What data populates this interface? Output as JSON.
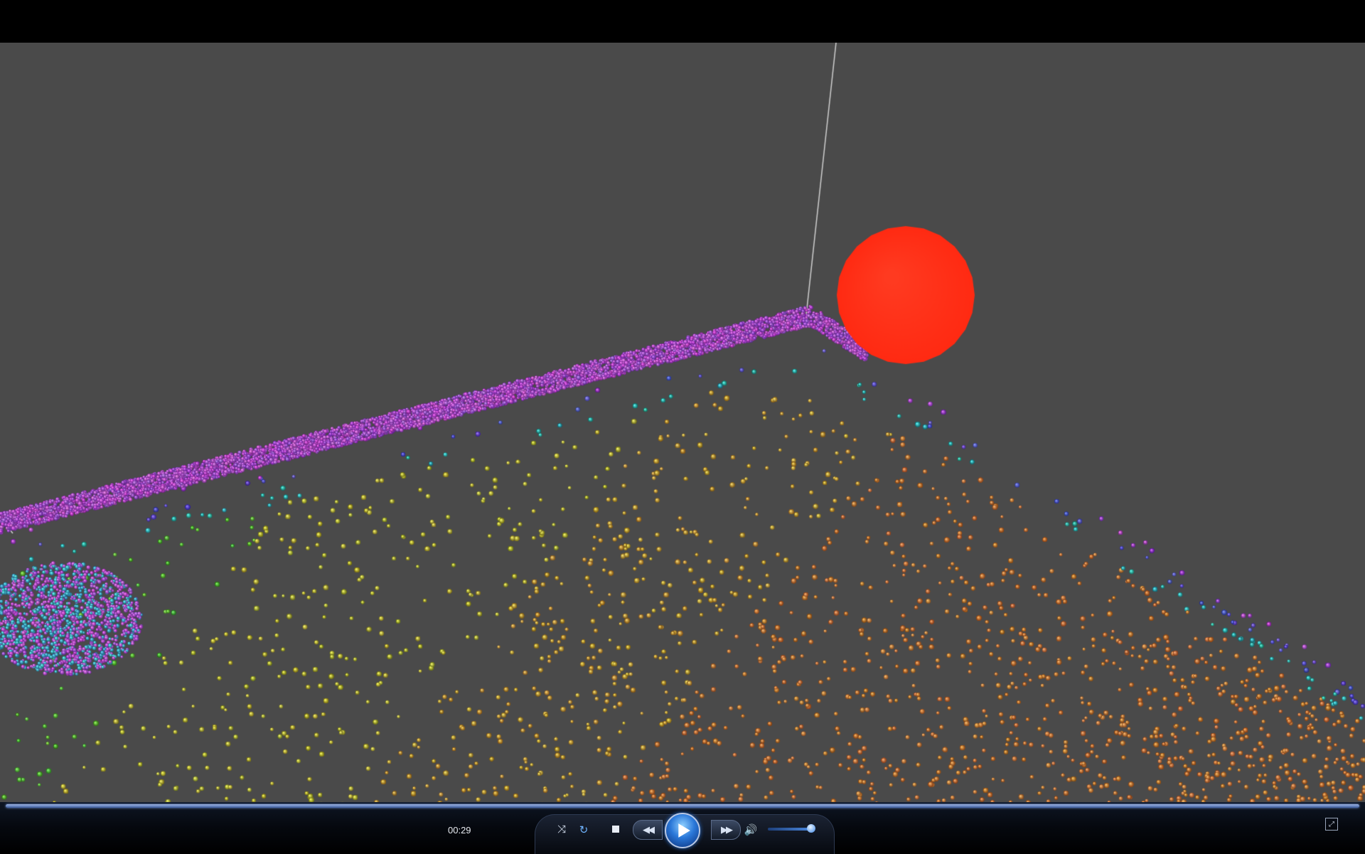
{
  "player": {
    "elapsed_time": "00:29",
    "seek_progress_fraction": 1.0,
    "volume_fraction": 0.85
  },
  "controls": {
    "shuffle_icon": "shuffle-icon",
    "repeat_icon": "repeat-icon",
    "stop_icon": "stop-icon",
    "previous_icon": "rewind-icon",
    "play_icon": "play-icon",
    "next_icon": "fast-forward-icon",
    "mute_icon": "speaker-icon",
    "fullscreen_icon": "fullscreen-icon"
  },
  "scene": {
    "background_color": "#4a4a4a",
    "sphere_color": "#ff2a12",
    "particle_palette": [
      "#b23cf0",
      "#4a3ad8",
      "#1fb0a0",
      "#3cc020",
      "#c0c018",
      "#d08a18",
      "#d8651a"
    ]
  }
}
